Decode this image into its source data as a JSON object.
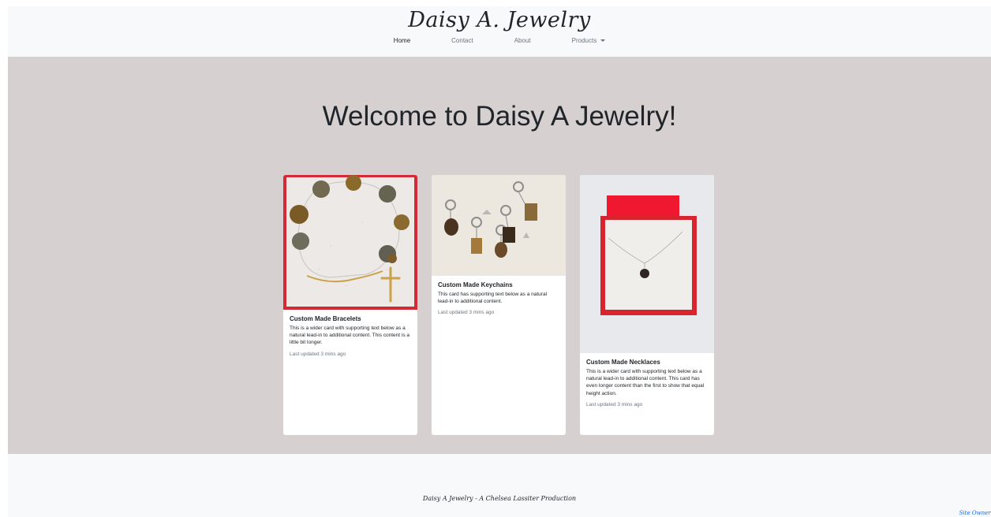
{
  "brand": "Daisy A. Jewelry",
  "nav": {
    "home": "Home",
    "contact": "Contact",
    "about": "About",
    "products": "Products"
  },
  "hero": {
    "title": "Welcome to Daisy A Jewelry!"
  },
  "cards": [
    {
      "title": "Custom Made Bracelets",
      "text": "This is a wider card with supporting text below as a natural lead-in to additional content. This content is a little bit longer.",
      "updated": "Last updated 3 mins ago"
    },
    {
      "title": "Custom Made Keychains",
      "text": "This card has supporting text below as a natural lead-in to additional content.",
      "updated": "Last updated 3 mins ago"
    },
    {
      "title": "Custom Made Necklaces",
      "text": "This is a wider card with supporting text below as a natural lead-in to additional content. This card has even longer content than the first to show that equal height action.",
      "updated": "Last updated 3 mins ago"
    }
  ],
  "footer": {
    "text": "Daisy A Jewelry - A Chelsea Lassiter Production",
    "link": "Site Owner Dashboard"
  },
  "colors": {
    "hero_bg": "#d6d0d0",
    "navbar_bg": "#f8f9fa",
    "link": "#0d6efd"
  }
}
